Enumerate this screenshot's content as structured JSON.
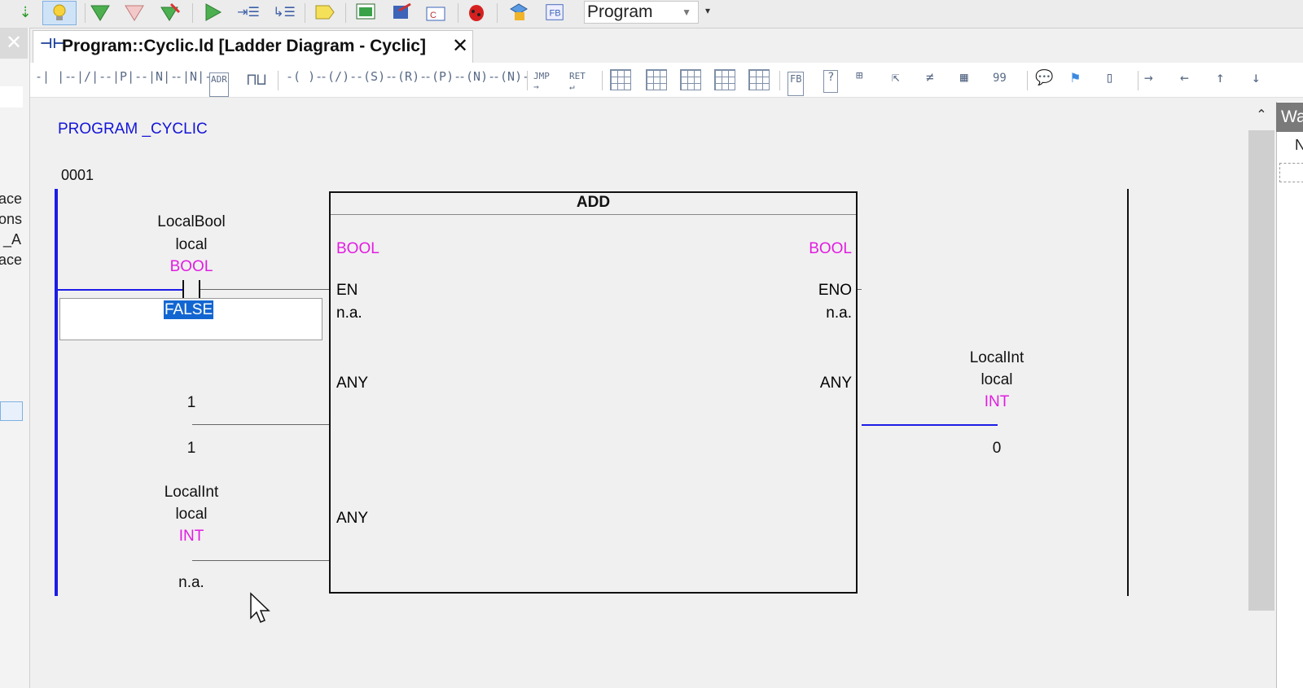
{
  "toolbar": {
    "program_select": {
      "value": "Program"
    }
  },
  "left_panel": {
    "fragments": [
      "ace",
      "ons",
      "_A",
      "ace"
    ]
  },
  "tab": {
    "title": "Program::Cyclic.ld [Ladder Diagram - Cyclic]",
    "close_glyph": "✕",
    "icon_glyph": "⊣⊢"
  },
  "ld_toolbar": {
    "jmp_label": "JMP",
    "ret_label": "RET",
    "fb_label": "FB",
    "num_label": "99"
  },
  "editor": {
    "program_title": "PROGRAM _CYCLIC",
    "rung_number": "0001",
    "contact": {
      "name": "LocalBool",
      "scope": "local",
      "type": "BOOL",
      "value": "FALSE"
    },
    "input_const": {
      "value_top": "1",
      "value_bottom": "1"
    },
    "input_var": {
      "name": "LocalInt",
      "scope": "local",
      "type": "INT",
      "value": "n.a."
    },
    "function_block": {
      "name": "ADD",
      "in_type": "BOOL",
      "out_type": "BOOL",
      "en": "EN",
      "en_value": "n.a.",
      "eno": "ENO",
      "eno_value": "n.a.",
      "in1_type": "ANY",
      "in2_type": "ANY",
      "out_any": "ANY"
    },
    "output_var": {
      "name": "LocalInt",
      "scope": "local",
      "type": "INT",
      "value": "0"
    }
  },
  "right_panel": {
    "tab_label": "Wa",
    "column_label": "N"
  },
  "colors": {
    "keyword_blue": "#1414d8",
    "type_magenta": "#e21ce2",
    "power_rail_blue": "#1c1ce6",
    "selection_blue": "#1266d1"
  }
}
